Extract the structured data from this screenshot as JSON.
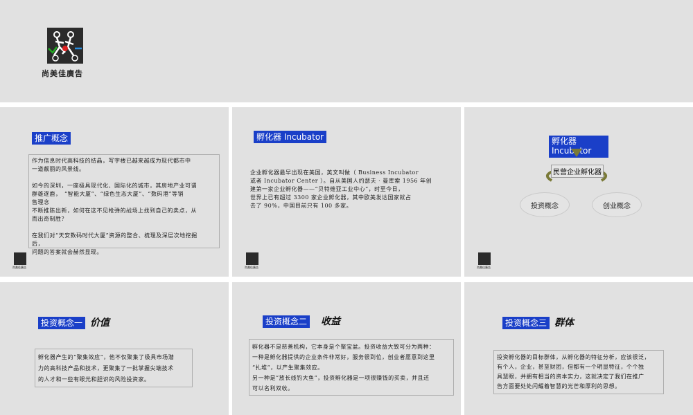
{
  "brand": {
    "name": "尚美佳廣告"
  },
  "slides": {
    "s1": {
      "title": "推广概念",
      "body": "作为信息时代高科技的结晶，写字楼已越来越成为现代都市中\n一道靓丽的风景线。\n\n如今的深圳，一座极具现代化、国际化的城市，其房地产业可谓\n群雄逐鹿，　“智能大厦”、“绿色生态大厦”、“数码港”等销\n售理念\n不断推陈出新，如何在这不见枪弹的战场上找到自己的卖点，从\n而出奇制胜？\n\n在我们对“天安数码时代大厦”资源的整合、梳理及深层次地挖掘\n后，\n问题的答案就会赫然显现。"
    },
    "s2": {
      "title": "孵化器 Incubator",
      "body": "企业孵化器最早出现在美国，英文叫做（ Business Incubator\n或者 Incubator Center ）。自从美国人约瑟夫 · 曼库索 1956 年创\n建第一家企业孵化器——“贝特维亚工业中心”，时至今日，\n世界上已有超过 3300 家企业孵化器，其中欧美发达国家就占\n去了 90%，中国目前只有 100 多家。"
    },
    "s3": {
      "title": "孵化器\nIncubator",
      "center": "民营企业孵化器",
      "left": "投资概念",
      "right": "创业概念"
    },
    "s4": {
      "title": "投资概念一",
      "subtitle": "价值",
      "body": "孵化器产生的“聚集效应”，他不仅聚集了极具市场潜\n力的高科技产品和技术，更聚集了一批掌握尖端技术\n的人才和一些有眼光和胆识的风险投资家。"
    },
    "s5": {
      "title": "投资概念二",
      "subtitle": "收益",
      "body": "孵化器不是慈善机构，它本身是个聚宝盆。投资收益大致可分为两种：\n一种是孵化器提供的企业条件非常好，服务很到位，创业者愿意到这里\n“扎堆”，以产生聚集效应。\n另一种是“放长线钓大鱼”，投资孵化器是一项很赚钱的买卖，并且还\n可以名利双收。"
    },
    "s6": {
      "title": "投资概念三",
      "subtitle": "群体",
      "body": "投资孵化器的目标群体，从孵化器的特征分析，应该很泛，\n有个人，企业，甚至财团，但都有一个明显特征，个个独\n具慧眼，并拥有相当的资本实力，这就决定了我们在推广\n告方面要处处闪耀着智慧的光芒和厚利的思想。"
    }
  }
}
